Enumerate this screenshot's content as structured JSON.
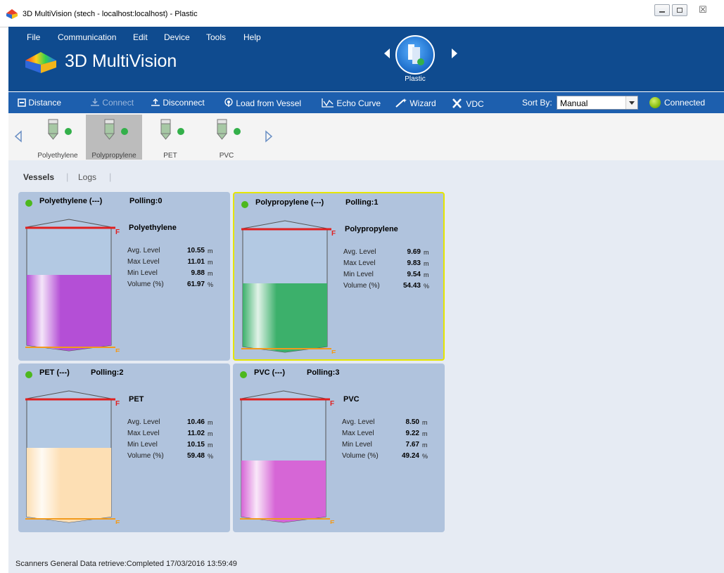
{
  "window": {
    "title": "3D MultiVision (stech - localhost:localhost) - Plastic",
    "close_glyph": "☒"
  },
  "menu": [
    "File",
    "Communication",
    "Edit",
    "Device",
    "Tools",
    "Help"
  ],
  "app_title": "3D MultiVision",
  "current_vessel": "Plastic",
  "toolbar": {
    "distance": "Distance",
    "connect": "Connect",
    "disconnect": "Disconnect",
    "load_from_vessel": "Load from Vessel",
    "echo_curve": "Echo Curve",
    "wizard": "Wizard",
    "vdc": "VDC",
    "sort_by_label": "Sort By:",
    "sort_by_value": "Manual",
    "connection_status": "Connected"
  },
  "strip": [
    "Polyethylene",
    "Polypropylene",
    "PET",
    "PVC"
  ],
  "tabs": {
    "vessels": "Vessels",
    "logs": "Logs",
    "separator": "|"
  },
  "labels": {
    "avg": "Avg. Level",
    "max": "Max Level",
    "min": "Min Level",
    "volume": "Volume (%)",
    "unit_m": "m",
    "unit_pct": "%",
    "full_marker": "F",
    "empty_marker": "E"
  },
  "vessels": [
    {
      "title": "Polyethylene (---)",
      "polling": "Polling:0",
      "name": "Polyethylene",
      "avg": "10.55",
      "max": "11.01",
      "min": "9.88",
      "volume": "61.97",
      "color": "#b44fd6"
    },
    {
      "title": "Polypropylene (---)",
      "polling": "Polling:1",
      "name": "Polypropylene",
      "avg": "9.69",
      "max": "9.83",
      "min": "9.54",
      "volume": "54.43",
      "color": "#3cb06b"
    },
    {
      "title": "PET (---)",
      "polling": "Polling:2",
      "name": "PET",
      "avg": "10.46",
      "max": "11.02",
      "min": "10.15",
      "volume": "59.48",
      "color": "#fddfb4"
    },
    {
      "title": "PVC (---)",
      "polling": "Polling:3",
      "name": "PVC",
      "avg": "8.50",
      "max": "9.22",
      "min": "7.67",
      "volume": "49.24",
      "color": "#d666d6"
    }
  ],
  "status": "Scanners General Data retrieve:Completed 17/03/2016 13:59:49"
}
